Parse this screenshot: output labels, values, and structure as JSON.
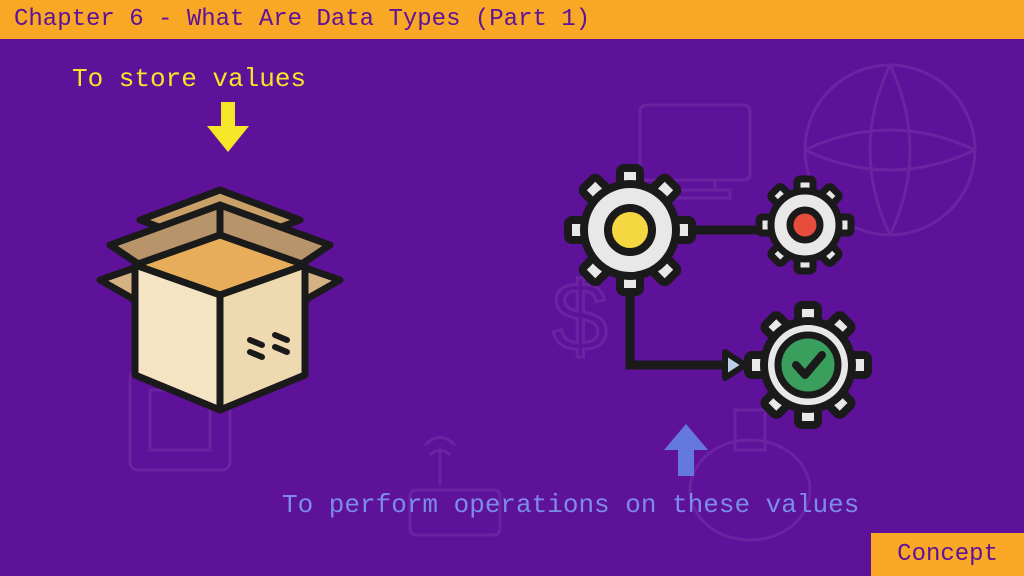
{
  "header": {
    "title": "Chapter 6 - What Are Data Types (Part 1)"
  },
  "labels": {
    "store": "To store values",
    "perform": "To perform operations on these values"
  },
  "badge": {
    "concept": "Concept"
  },
  "colors": {
    "bg": "#5e1199",
    "accent": "#f9a825",
    "yellow_text": "#f5e727",
    "blue_text": "#7b8ce8"
  },
  "icons": {
    "box": "open-box-icon",
    "gears": "gears-icon",
    "arrow_yellow": "arrow-down-yellow-icon",
    "arrow_blue": "arrow-up-blue-icon"
  }
}
